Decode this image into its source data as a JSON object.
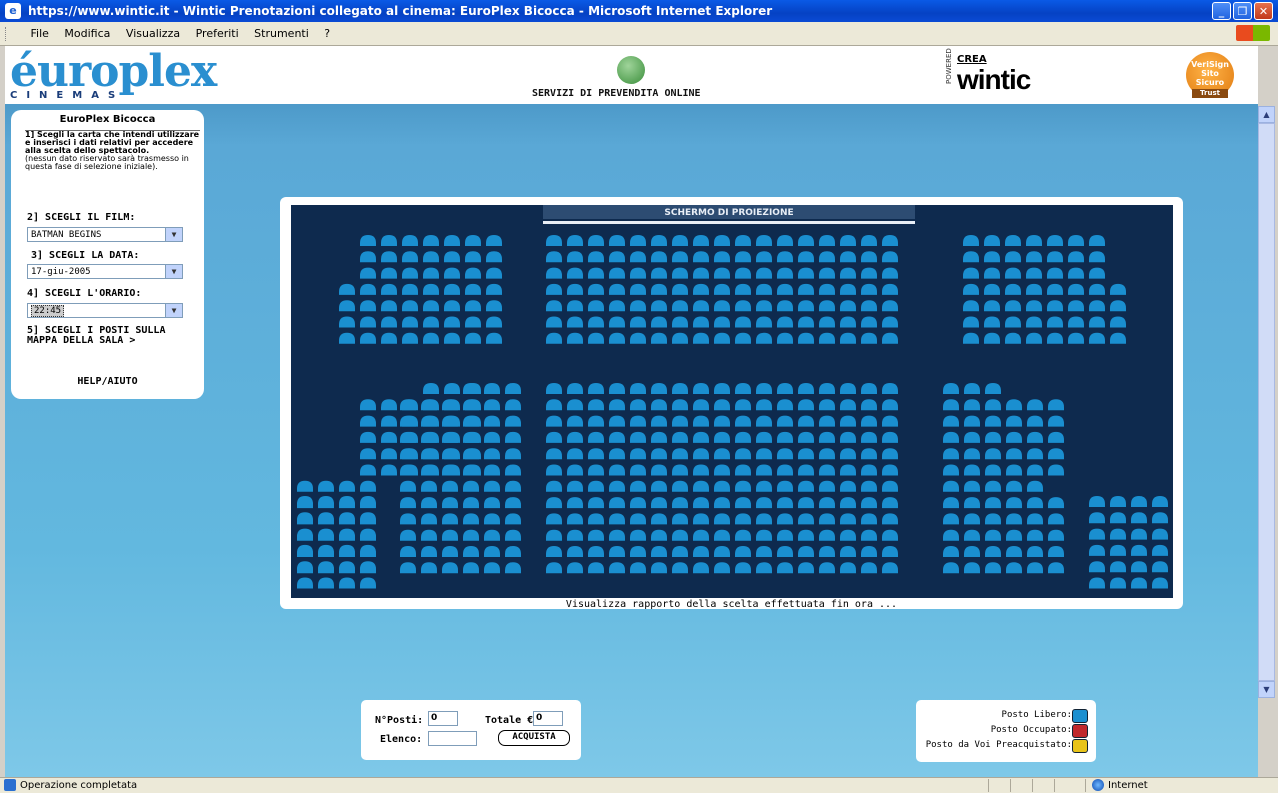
{
  "window": {
    "title": "https://www.wintic.it - Wintic Prenotazioni collegato al cinema: EuroPlex Bicocca - Microsoft Internet Explorer",
    "minimize": "_",
    "maximize": "❐",
    "close": "✕"
  },
  "menu": [
    "File",
    "Modifica",
    "Visualizza",
    "Preferiti",
    "Strumenti",
    "?"
  ],
  "header": {
    "logo_word": "éuroplex",
    "logo_sub": "CINEMAS",
    "servizi": "SERVIZI DI PREVENDITA ONLINE",
    "powered": "POWERED",
    "crea": "CREA",
    "wintic": "wintic",
    "badge_top": "VeriSign",
    "badge_mid": "Sito Sicuro",
    "badge_bottom": "Trust"
  },
  "sidebar": {
    "cinema": "EuroPlex Bicocca",
    "step1_bold": "1] Scegli la carta che intendi utilizzare e inserisci i dati relativi per accedere alla scelta dello spettacolo.",
    "step1_note": "(nessun dato riservato sarà trasmesso in questa fase di selezione iniziale).",
    "step2_label": "2] SCEGLI IL FILM:",
    "film": "BATMAN BEGINS",
    "step3_label": "3] SCEGLI LA DATA:",
    "data": "17-giu-2005",
    "step4_label": "4] SCEGLI L'ORARIO:",
    "orario": "22:45",
    "step5_label": "5] SCEGLI I POSTI SULLA MAPPA DELLA SALA >",
    "help": "HELP/AIUTO"
  },
  "hall": {
    "screen_label": "SCHERMO DI PROIEZIONE",
    "rapporto": "Visualizza rapporto della scelta effettuata fin ora ...",
    "seat_color": "#1a8fd0",
    "bg_color": "#0e2a4e"
  },
  "purchase": {
    "posti_label": "N°Posti:",
    "posti_value": "0",
    "totale_label": "Totale €",
    "totale_value": "0",
    "elenco_label": "Elenco:",
    "elenco_value": "",
    "acquista": "ACQUISTA"
  },
  "legend": {
    "libero": "Posto Libero:",
    "occupato": "Posto Occupato:",
    "preacquistato": "Posto da Voi Preacquistato:",
    "libero_color": "#1a8fd0",
    "occupato_color": "#c0282c",
    "preacquistato_color": "#e8c41a"
  },
  "status": {
    "message": "Operazione completata",
    "zone": "Internet"
  }
}
